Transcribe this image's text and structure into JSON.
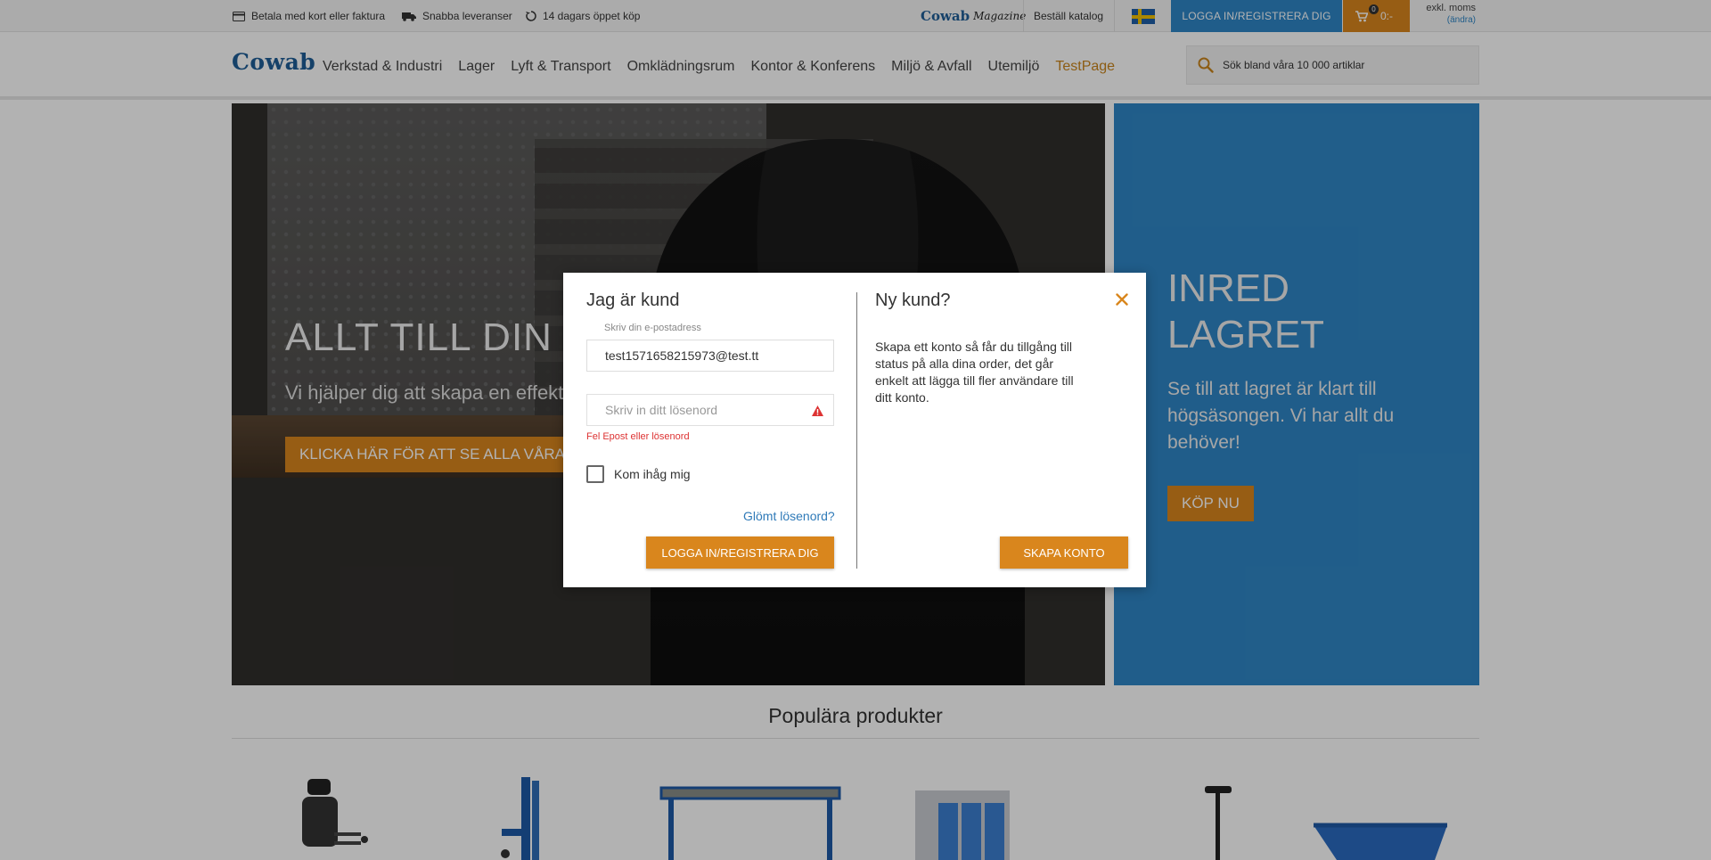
{
  "topbar": {
    "usps": [
      {
        "icon": "card-icon",
        "text": "Betala med kort eller faktura"
      },
      {
        "icon": "truck-icon",
        "text": "Snabba leveranser"
      },
      {
        "icon": "return-icon",
        "text": "14 dagars öppet köp"
      }
    ],
    "magazine_brand": "Cowab",
    "magazine_word": "Magazine",
    "catalog_link": "Beställ katalog",
    "flag": "sweden-flag-icon",
    "login_button": "LOGGA IN/REGISTRERA DIG",
    "cart_count": "0",
    "cart_total": "0:-",
    "vat_label": "exkl. moms",
    "vat_change": "(ändra)"
  },
  "header": {
    "logo": "Cowab",
    "nav": [
      "Verkstad & Industri",
      "Lager",
      "Lyft & Transport",
      "Omklädningsrum",
      "Kontor & Konferens",
      "Miljö & Avfall",
      "Utemiljö",
      "TestPage"
    ],
    "search_placeholder": "Sök bland våra 10 000 artiklar"
  },
  "hero": {
    "title": "ALLT TILL DIN VERKSTAD",
    "subtitle": "Vi hjälper dig att skapa en effektiv arbetsplats",
    "cta": "KLICKA HÄR FÖR ATT SE ALLA VÅRA PRODUKTER"
  },
  "promo": {
    "title": "INRED LAGRET",
    "text": "Se till att lagret är klart till högsäsongen. Vi har allt du behöver!",
    "cta": "KÖP NU"
  },
  "popular": {
    "title": "Populära produkter"
  },
  "modal": {
    "login_heading": "Jag är kund",
    "email_label": "Skriv din e-postadress",
    "email_value": "test1571658215973@test.tt",
    "password_placeholder": "Skriv in ditt lösenord",
    "error_text": "Fel Epost eller lösenord",
    "remember_label": "Kom ihåg mig",
    "remember_checked": false,
    "forgot_link": "Glömt lösenord?",
    "login_button": "LOGGA IN/REGISTRERA DIG",
    "new_heading": "Ny kund?",
    "new_text": "Skapa ett konto så får du tillgång till status på alla dina order, det går enkelt att lägga till fler användare till ditt konto.",
    "create_button": "SKAPA KONTO"
  },
  "colors": {
    "accent_orange": "#d9861d",
    "accent_blue": "#2f86c6",
    "brand_blue": "#1f5d97",
    "error_red": "#d33"
  }
}
